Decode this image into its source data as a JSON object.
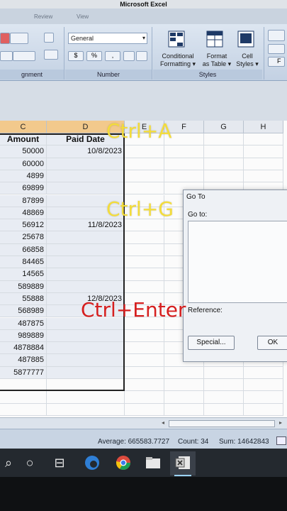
{
  "window": {
    "title": "Microsoft Excel"
  },
  "ribbon": {
    "tabs": [
      "Review",
      "View"
    ],
    "groups": {
      "alignment": "gnment",
      "number": "Number",
      "styles": "Styles"
    },
    "number_format": "General",
    "number_buttons": [
      "$",
      "%",
      ","
    ],
    "styles_buttons": {
      "conditional_formatting": [
        "Conditional",
        "Formatting ▾"
      ],
      "format_as_table": [
        "Format",
        "as Table ▾"
      ],
      "cell_styles": [
        "Cell",
        "Styles ▾"
      ]
    },
    "overflow_label": "F"
  },
  "sheet": {
    "columns": [
      "C",
      "D",
      "E",
      "F",
      "G",
      "H"
    ],
    "header_row": {
      "amount": "Amount",
      "paid_date": "Paid Date"
    },
    "rows": [
      {
        "amount": "50000",
        "paid_date": "10/8/2023"
      },
      {
        "amount": "60000",
        "paid_date": ""
      },
      {
        "amount": "4899",
        "paid_date": ""
      },
      {
        "amount": "69899",
        "paid_date": ""
      },
      {
        "amount": "87899",
        "paid_date": ""
      },
      {
        "amount": "48869",
        "paid_date": ""
      },
      {
        "amount": "56912",
        "paid_date": "11/8/2023"
      },
      {
        "amount": "25678",
        "paid_date": ""
      },
      {
        "amount": "66858",
        "paid_date": ""
      },
      {
        "amount": "84465",
        "paid_date": ""
      },
      {
        "amount": "14565",
        "paid_date": ""
      },
      {
        "amount": "589889",
        "paid_date": ""
      },
      {
        "amount": "55888",
        "paid_date": "12/8/2023"
      },
      {
        "amount": "568989",
        "paid_date": ""
      },
      {
        "amount": "487875",
        "paid_date": ""
      },
      {
        "amount": "989889",
        "paid_date": ""
      },
      {
        "amount": "4878884",
        "paid_date": ""
      },
      {
        "amount": "487885",
        "paid_date": ""
      },
      {
        "amount": "5877777",
        "paid_date": ""
      }
    ]
  },
  "dialog": {
    "title": "Go To",
    "goto_label": "Go to:",
    "reference_label": "Reference:",
    "special_button": "Special...",
    "ok_button": "OK"
  },
  "status": {
    "average": "Average: 665583.7727",
    "count": "Count: 34",
    "sum": "Sum: 14642843"
  },
  "overlay": {
    "select_all": "Ctrl+A",
    "go_to": "Ctrl+G",
    "fill": "Ctrl+Enter"
  },
  "colors": {
    "selected_column_header": "#f2c98c",
    "shortcut_yellow": "#f3dc3a",
    "shortcut_red": "#d61f1f",
    "taskbar": "#24292f"
  }
}
